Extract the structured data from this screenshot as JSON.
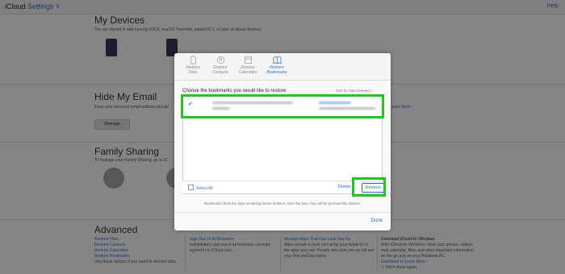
{
  "topbar": {
    "brand_a": "iCloud",
    "brand_b": "Settings ˅",
    "right_link": "Help"
  },
  "sections": {
    "devices": {
      "title": "My Devices",
      "desc": "You are signed in and running iOS 8, macOS Yosemite, watchOS 1, or later on these devices."
    },
    "hide_email": {
      "title": "Hide My Email",
      "desc": "Keep your personal email address private",
      "button": "Manage",
      "learn_more": "Learn More ›"
    },
    "family": {
      "title": "Family Sharing",
      "desc": "To manage your Family Sharing, go to iC"
    },
    "advanced": {
      "title": "Advanced",
      "col1": {
        "links": [
          "Restore Files",
          "Restore Contacts",
          "Restore Calendars",
          "Restore Bookmarks"
        ],
        "text": "Use these options if you need to recover data."
      },
      "col2": {
        "link": "Sign Out Of All Browsers",
        "text": "Immediately sign out of all browsers currently signed in to iCloud.com."
      },
      "col3": {
        "link": "Manage Apps That Can Look You Up",
        "text": "Allow people to look you up by your Apple ID in the apps you use. People who look you up will see your first and last name."
      },
      "col4": {
        "title": "Download iCloud for Windows",
        "text": "With iCloud for Windows, have your photos, videos, mail, calendar, files, and other important information on the go and on your Windows PC.",
        "link": "Download or Learn More ›",
        "checkbox": "Don't show again"
      }
    }
  },
  "modal": {
    "tabs": [
      {
        "line1": "Restore",
        "line2": "Files"
      },
      {
        "line1": "Restore",
        "line2": "Contacts"
      },
      {
        "line1": "Restore",
        "line2": "Calendars"
      },
      {
        "line1": "Restore",
        "line2": "Bookmarks"
      }
    ],
    "prompt": "Choose the bookmarks you would like to restore:",
    "sort": "Sort by Date Deleted ˅",
    "row_check": "✔",
    "select_all": "Select All",
    "delete": "Delete",
    "restore": "Restore",
    "note": "Bookmarks show the days remaining before deletion. After that time, they will be permanently deleted.",
    "done": "Done"
  },
  "colors": {
    "accent": "#2a6fc9",
    "highlight": "#23c423"
  }
}
